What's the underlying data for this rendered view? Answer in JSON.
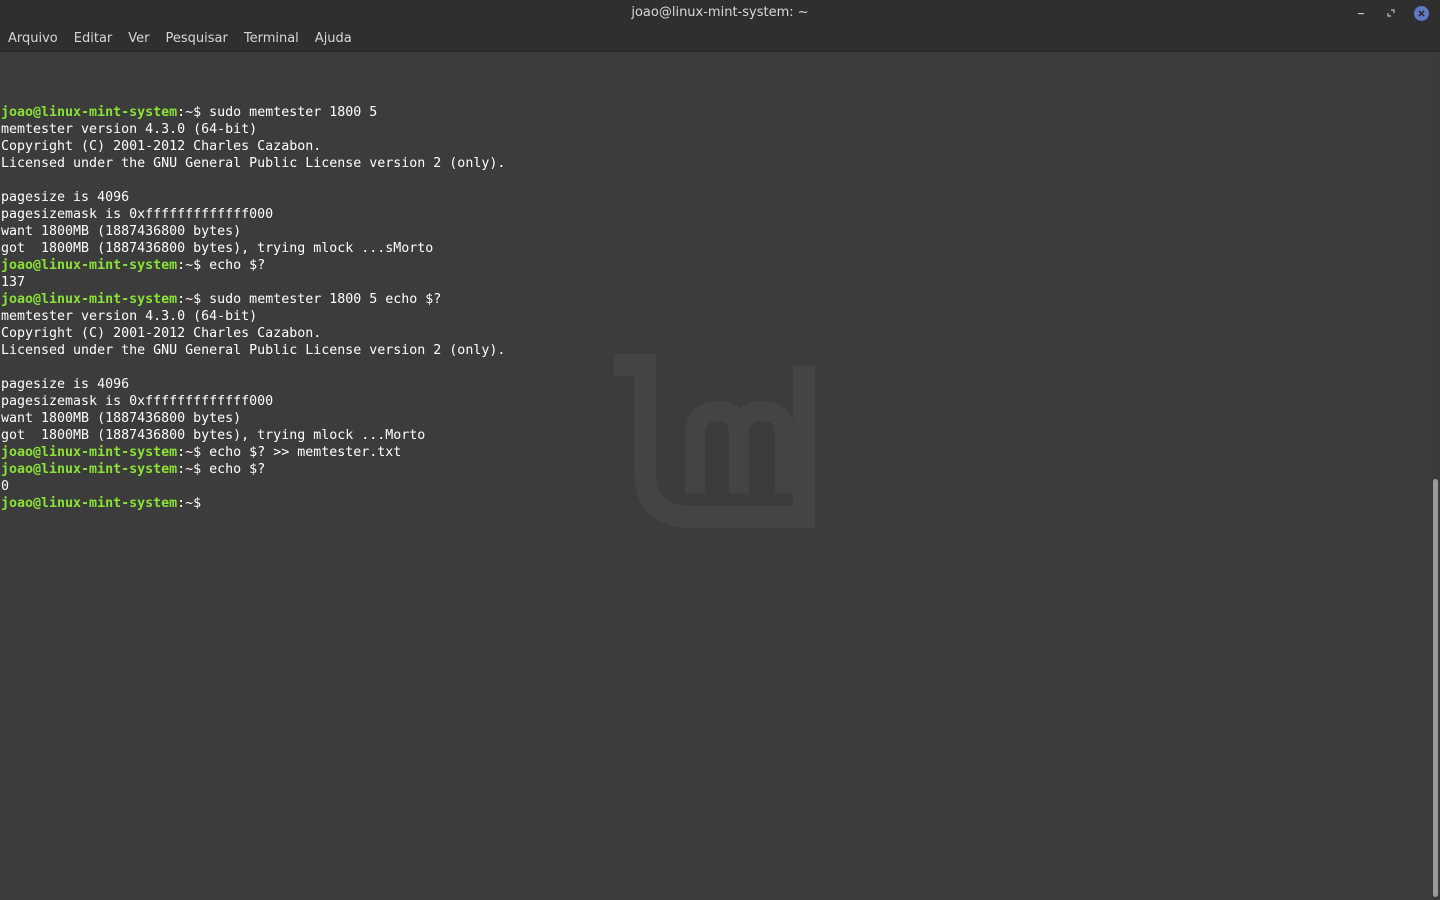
{
  "window": {
    "title": "joao@linux-mint-system: ~"
  },
  "menu": {
    "items": [
      "Arquivo",
      "Editar",
      "Ver",
      "Pesquisar",
      "Terminal",
      "Ajuda"
    ]
  },
  "terminal": {
    "colors": {
      "background": "#3c3c3c",
      "text": "#ffffff",
      "prompt_user": "#8ae234"
    },
    "lines": [
      {
        "prompt": "joao@linux-mint-system",
        "path": ":~$ ",
        "cmd": "sudo memtester 1800 5"
      },
      {
        "text": "memtester version 4.3.0 (64-bit)"
      },
      {
        "text": "Copyright (C) 2001-2012 Charles Cazabon."
      },
      {
        "text": "Licensed under the GNU General Public License version 2 (only)."
      },
      {
        "text": ""
      },
      {
        "text": "pagesize is 4096"
      },
      {
        "text": "pagesizemask is 0xfffffffffffff000"
      },
      {
        "text": "want 1800MB (1887436800 bytes)"
      },
      {
        "text": "got  1800MB (1887436800 bytes), trying mlock ...sMorto"
      },
      {
        "prompt": "joao@linux-mint-system",
        "path": ":~$ ",
        "cmd": "echo $?"
      },
      {
        "text": "137"
      },
      {
        "prompt": "joao@linux-mint-system",
        "path": ":~$ ",
        "cmd": "sudo memtester 1800 5 echo $?"
      },
      {
        "text": "memtester version 4.3.0 (64-bit)"
      },
      {
        "text": "Copyright (C) 2001-2012 Charles Cazabon."
      },
      {
        "text": "Licensed under the GNU General Public License version 2 (only)."
      },
      {
        "text": ""
      },
      {
        "text": "pagesize is 4096"
      },
      {
        "text": "pagesizemask is 0xfffffffffffff000"
      },
      {
        "text": "want 1800MB (1887436800 bytes)"
      },
      {
        "text": "got  1800MB (1887436800 bytes), trying mlock ...Morto"
      },
      {
        "prompt": "joao@linux-mint-system",
        "path": ":~$ ",
        "cmd": "echo $? >> memtester.txt"
      },
      {
        "prompt": "joao@linux-mint-system",
        "path": ":~$ ",
        "cmd": "echo $?"
      },
      {
        "text": "0"
      },
      {
        "prompt": "joao@linux-mint-system",
        "path": ":~$ ",
        "cmd": ""
      }
    ]
  },
  "icons": {
    "minimize": "minimize-icon",
    "maximize": "maximize-icon",
    "close": "close-icon",
    "watermark": "linux-mint-logo"
  }
}
